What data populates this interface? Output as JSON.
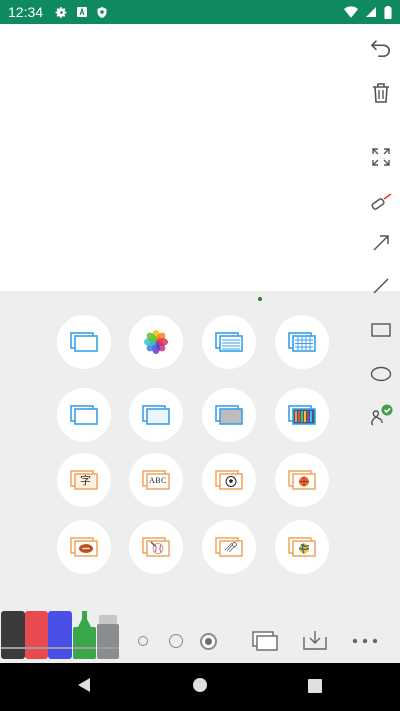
{
  "status_bar": {
    "time": "12:34",
    "color": "#0f8a5f",
    "left_icons": [
      "gear-icon",
      "font-a-icon",
      "shield-icon"
    ],
    "right_icons": [
      "wifi-icon",
      "signal-icon",
      "battery-icon"
    ]
  },
  "toolbar": {
    "items": [
      {
        "name": "undo-tool",
        "icon": "undo-icon"
      },
      {
        "name": "delete-tool",
        "icon": "trash-icon"
      },
      {
        "name": "fullscreen-tool",
        "icon": "expand-icon"
      },
      {
        "name": "laser-pointer-tool",
        "icon": "laser-pointer-icon"
      },
      {
        "name": "arrow-tool",
        "icon": "arrow-icon"
      },
      {
        "name": "line-tool",
        "icon": "line-icon"
      },
      {
        "name": "rectangle-tool",
        "icon": "rectangle-icon"
      },
      {
        "name": "ellipse-tool",
        "icon": "ellipse-icon"
      },
      {
        "name": "freehand-shape-tool",
        "icon": "freehand-check-icon"
      }
    ]
  },
  "backgrounds": [
    {
      "name": "bg-blank-board",
      "icon": "blank-board-icon"
    },
    {
      "name": "bg-photos",
      "icon": "photos-icon"
    },
    {
      "name": "bg-lined",
      "icon": "lined-board-icon"
    },
    {
      "name": "bg-grid",
      "icon": "grid-board-icon"
    },
    {
      "name": "bg-white",
      "icon": "white-board-icon"
    },
    {
      "name": "bg-blue-frame",
      "icon": "blue-frame-icon"
    },
    {
      "name": "bg-gray",
      "icon": "gray-board-icon"
    },
    {
      "name": "bg-bookshelf",
      "icon": "bookshelf-icon"
    },
    {
      "name": "bg-chinese-character",
      "icon": "chinese-practice-icon",
      "glyph": "字"
    },
    {
      "name": "bg-abc-handwriting",
      "icon": "abc-practice-icon",
      "glyph": "ABC"
    },
    {
      "name": "bg-soccer-field",
      "icon": "soccer-icon"
    },
    {
      "name": "bg-basketball-court",
      "icon": "basketball-icon"
    },
    {
      "name": "bg-football-field",
      "icon": "football-icon"
    },
    {
      "name": "bg-baseball-field",
      "icon": "baseball-icon"
    },
    {
      "name": "bg-badminton-court",
      "icon": "badminton-icon"
    },
    {
      "name": "bg-volleyball-court",
      "icon": "volleyball-icon"
    }
  ],
  "markers": [
    {
      "name": "marker-black",
      "color": "#3b3b3b"
    },
    {
      "name": "marker-red",
      "color": "#e84a4f"
    },
    {
      "name": "marker-blue",
      "color": "#4a4fe8"
    },
    {
      "name": "marker-green",
      "color": "#3aa84a"
    },
    {
      "name": "marker-gray",
      "color": "#8a8d8f"
    }
  ],
  "sizes": [
    "size-small",
    "size-medium",
    "size-large"
  ],
  "bottom_actions": [
    {
      "name": "background-button",
      "icon": "layers-icon"
    },
    {
      "name": "save-button",
      "icon": "download-icon"
    },
    {
      "name": "more-button",
      "icon": "more-icon"
    }
  ],
  "nav": [
    "back-icon",
    "home-icon",
    "recents-icon"
  ]
}
